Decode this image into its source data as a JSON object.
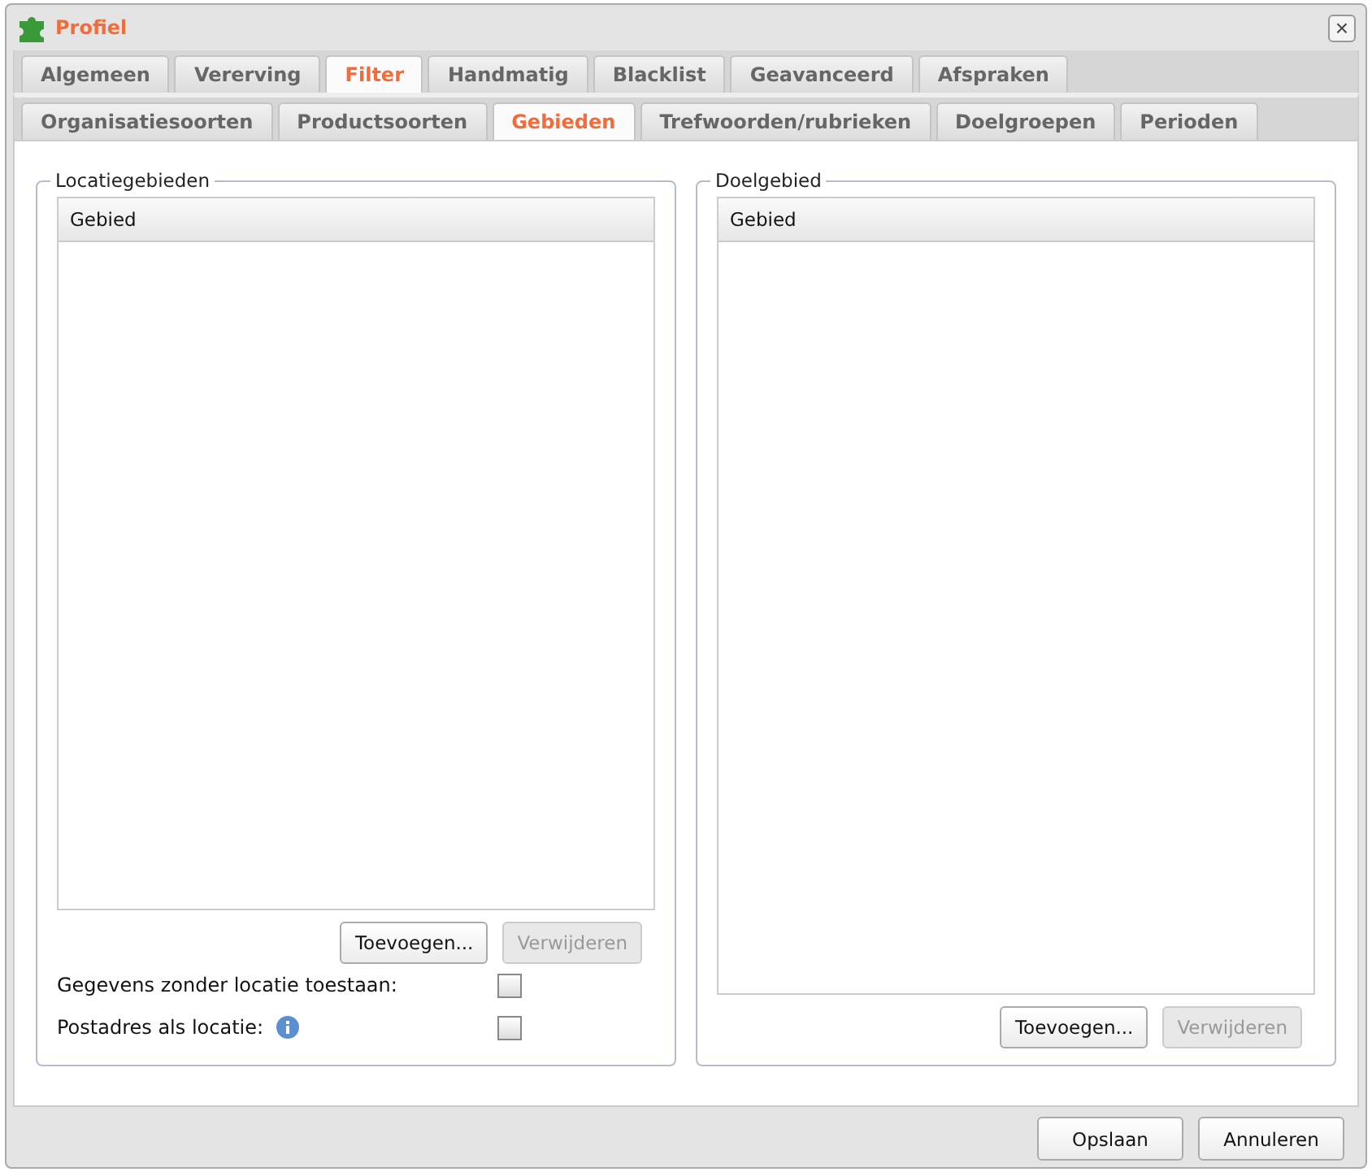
{
  "window": {
    "title": "Profiel",
    "close": "×"
  },
  "tabs": [
    {
      "label": "Algemeen",
      "selected": false
    },
    {
      "label": "Vererving",
      "selected": false
    },
    {
      "label": "Filter",
      "selected": true
    },
    {
      "label": "Handmatig",
      "selected": false
    },
    {
      "label": "Blacklist",
      "selected": false
    },
    {
      "label": "Geavanceerd",
      "selected": false
    },
    {
      "label": "Afspraken",
      "selected": false
    }
  ],
  "subtabs": [
    {
      "label": "Organisatiesoorten",
      "selected": false
    },
    {
      "label": "Productsoorten",
      "selected": false
    },
    {
      "label": "Gebieden",
      "selected": true
    },
    {
      "label": "Trefwoorden/rubrieken",
      "selected": false
    },
    {
      "label": "Doelgroepen",
      "selected": false
    },
    {
      "label": "Perioden",
      "selected": false
    }
  ],
  "panels": [
    {
      "legend": "Locatiegebieden",
      "column": "Gebied",
      "buttons": [
        {
          "label": "Toevoegen...",
          "disabled": false
        },
        {
          "label": "Verwijderen",
          "disabled": true
        }
      ],
      "options": [
        {
          "label": "Gegevens zonder locatie toestaan:",
          "info": false,
          "checked": false
        },
        {
          "label": "Postadres als locatie:",
          "info": true,
          "checked": false
        }
      ]
    },
    {
      "legend": "Doelgebied",
      "column": "Gebied",
      "buttons": [
        {
          "label": "Toevoegen...",
          "disabled": false
        },
        {
          "label": "Verwijderen",
          "disabled": true
        }
      ]
    }
  ],
  "footer": [
    "Opslaan",
    "Annuleren"
  ]
}
